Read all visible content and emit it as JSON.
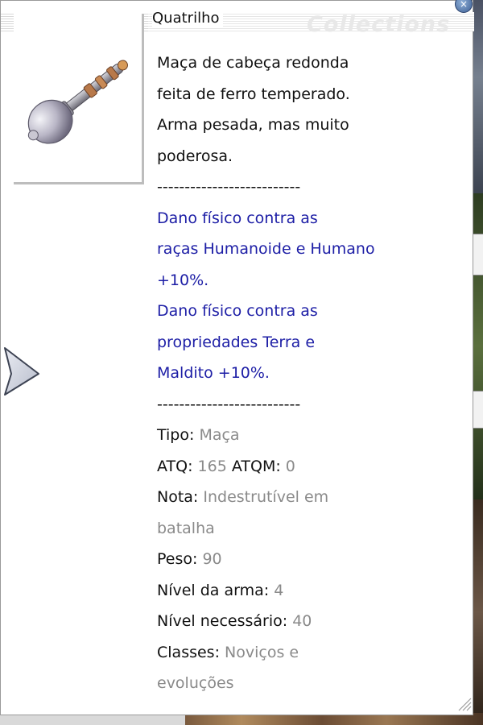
{
  "window": {
    "item_name": "Quatrilho",
    "watermark": "Collections",
    "close_icon": "close-icon",
    "nav_icon": "triangle-pointer-icon"
  },
  "description": {
    "text_lines": [
      "Maça de cabeça redonda",
      "feita de ferro temperado.",
      "Arma pesada, mas muito",
      "poderosa."
    ],
    "separator_1": "--------------------------",
    "effect_lines": [
      "Dano físico contra as",
      "raças Humanoide e Humano",
      "+10%.",
      "Dano físico contra as",
      "propriedades Terra e",
      "Maldito +10%."
    ],
    "separator_2": "--------------------------"
  },
  "stats": {
    "tipo_label": "Tipo:",
    "tipo_value": "Maça",
    "atq_label": "ATQ:",
    "atq_value": "165",
    "atqm_label": "ATQM:",
    "atqm_value": "0",
    "nota_label": "Nota:",
    "nota_value_1": "Indestrutível em",
    "nota_value_2": "batalha",
    "peso_label": "Peso:",
    "peso_value": "90",
    "nivel_arma_label": "Nível da arma:",
    "nivel_arma_value": "4",
    "nivel_nec_label": "Nível necessário:",
    "nivel_nec_value": "40",
    "classes_label": "Classes:",
    "classes_value_1": "Noviços e",
    "classes_value_2": "evoluções"
  },
  "colors": {
    "effect_text": "#1d1ea6",
    "value_text": "#8a8a8a"
  }
}
